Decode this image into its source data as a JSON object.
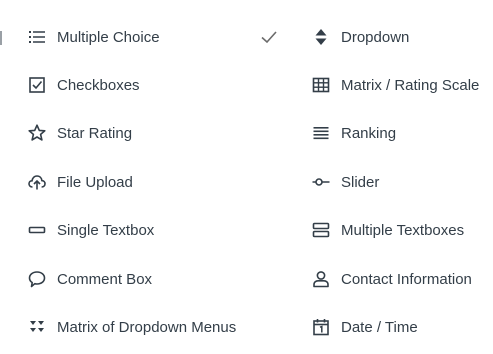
{
  "menu": {
    "selected_item": "Multiple Choice",
    "items": [
      {
        "label": "Multiple Choice",
        "icon": "list-icon"
      },
      {
        "label": "Dropdown",
        "icon": "sort-arrows-icon"
      },
      {
        "label": "Checkboxes",
        "icon": "checkbox-icon"
      },
      {
        "label": "Matrix / Rating Scale",
        "icon": "grid-icon"
      },
      {
        "label": "Star Rating",
        "icon": "star-icon"
      },
      {
        "label": "Ranking",
        "icon": "ranking-lines-icon"
      },
      {
        "label": "File Upload",
        "icon": "cloud-upload-icon"
      },
      {
        "label": "Slider",
        "icon": "slider-icon"
      },
      {
        "label": "Single Textbox",
        "icon": "textbox-icon"
      },
      {
        "label": "Multiple Textboxes",
        "icon": "multiple-textboxes-icon"
      },
      {
        "label": "Comment Box",
        "icon": "speech-bubble-icon"
      },
      {
        "label": "Contact Information",
        "icon": "person-icon"
      },
      {
        "label": "Matrix of Dropdown Menus",
        "icon": "dropdown-matrix-icon"
      },
      {
        "label": "Date / Time",
        "icon": "calendar-icon"
      }
    ]
  },
  "colors": {
    "text": "#333e48",
    "icon": "#333e48",
    "checkmark": "#6b6b6b",
    "background": "#ffffff"
  }
}
